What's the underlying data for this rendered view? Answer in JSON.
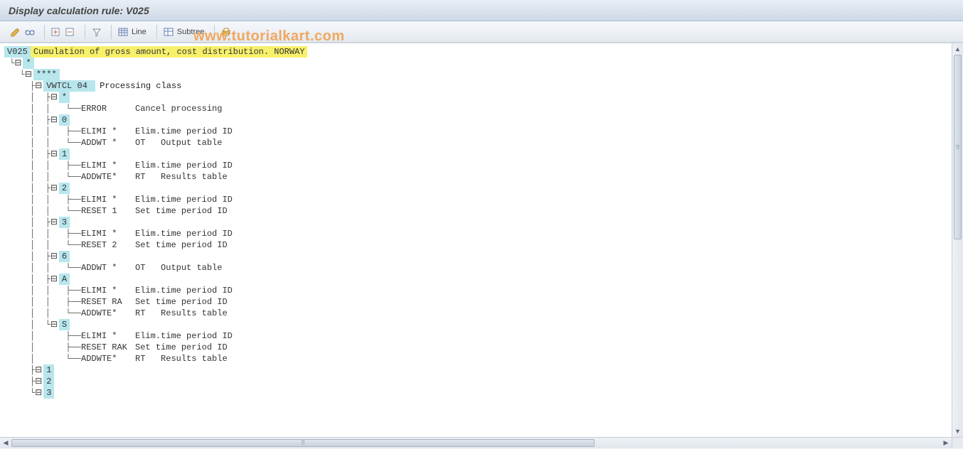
{
  "title": "Display calculation rule: V025",
  "watermark": "www.tutorialkart.com",
  "toolbar": {
    "line_label": "Line",
    "subtree_label": "Subtree"
  },
  "tree": {
    "root_code": "V025",
    "root_desc": "Cumulation of gross amount, cost distribution. NORWAY",
    "star": "*",
    "stars4": "****",
    "vwtcl_code": "VWTCL 04",
    "vwtcl_desc": "Processing class",
    "branches": [
      {
        "key": "*",
        "lines": [
          {
            "op": "ERROR",
            "extra": "",
            "desc": "Cancel processing"
          }
        ]
      },
      {
        "key": "0",
        "lines": [
          {
            "op": "ELIMI *",
            "extra": "",
            "desc": "Elim.time period ID"
          },
          {
            "op": "ADDWT *",
            "extra": "OT",
            "desc": "Output table"
          }
        ]
      },
      {
        "key": "1",
        "lines": [
          {
            "op": "ELIMI *",
            "extra": "",
            "desc": "Elim.time period ID"
          },
          {
            "op": "ADDWTE*",
            "extra": "RT",
            "desc": "Results table"
          }
        ]
      },
      {
        "key": "2",
        "lines": [
          {
            "op": "ELIMI *",
            "extra": "",
            "desc": "Elim.time period ID"
          },
          {
            "op": "RESET 1",
            "extra": "",
            "desc": "Set time period ID"
          }
        ]
      },
      {
        "key": "3",
        "lines": [
          {
            "op": "ELIMI *",
            "extra": "",
            "desc": "Elim.time period ID"
          },
          {
            "op": "RESET 2",
            "extra": "",
            "desc": "Set time period ID"
          }
        ]
      },
      {
        "key": "6",
        "lines": [
          {
            "op": "ADDWT *",
            "extra": "OT",
            "desc": "Output table"
          }
        ]
      },
      {
        "key": "A",
        "lines": [
          {
            "op": "ELIMI *",
            "extra": "",
            "desc": "Elim.time period ID"
          },
          {
            "op": "RESET RA",
            "extra": "",
            "desc": "Set time period ID"
          },
          {
            "op": "ADDWTE*",
            "extra": "RT",
            "desc": "Results table"
          }
        ]
      },
      {
        "key": "S",
        "lines": [
          {
            "op": "ELIMI *",
            "extra": "",
            "desc": "Elim.time period ID"
          },
          {
            "op": "RESET RAK",
            "extra": "",
            "desc": "Set time period ID"
          },
          {
            "op": "ADDWTE*",
            "extra": "RT",
            "desc": "Results table"
          }
        ]
      }
    ],
    "trailers": [
      "1",
      "2",
      "3"
    ]
  }
}
